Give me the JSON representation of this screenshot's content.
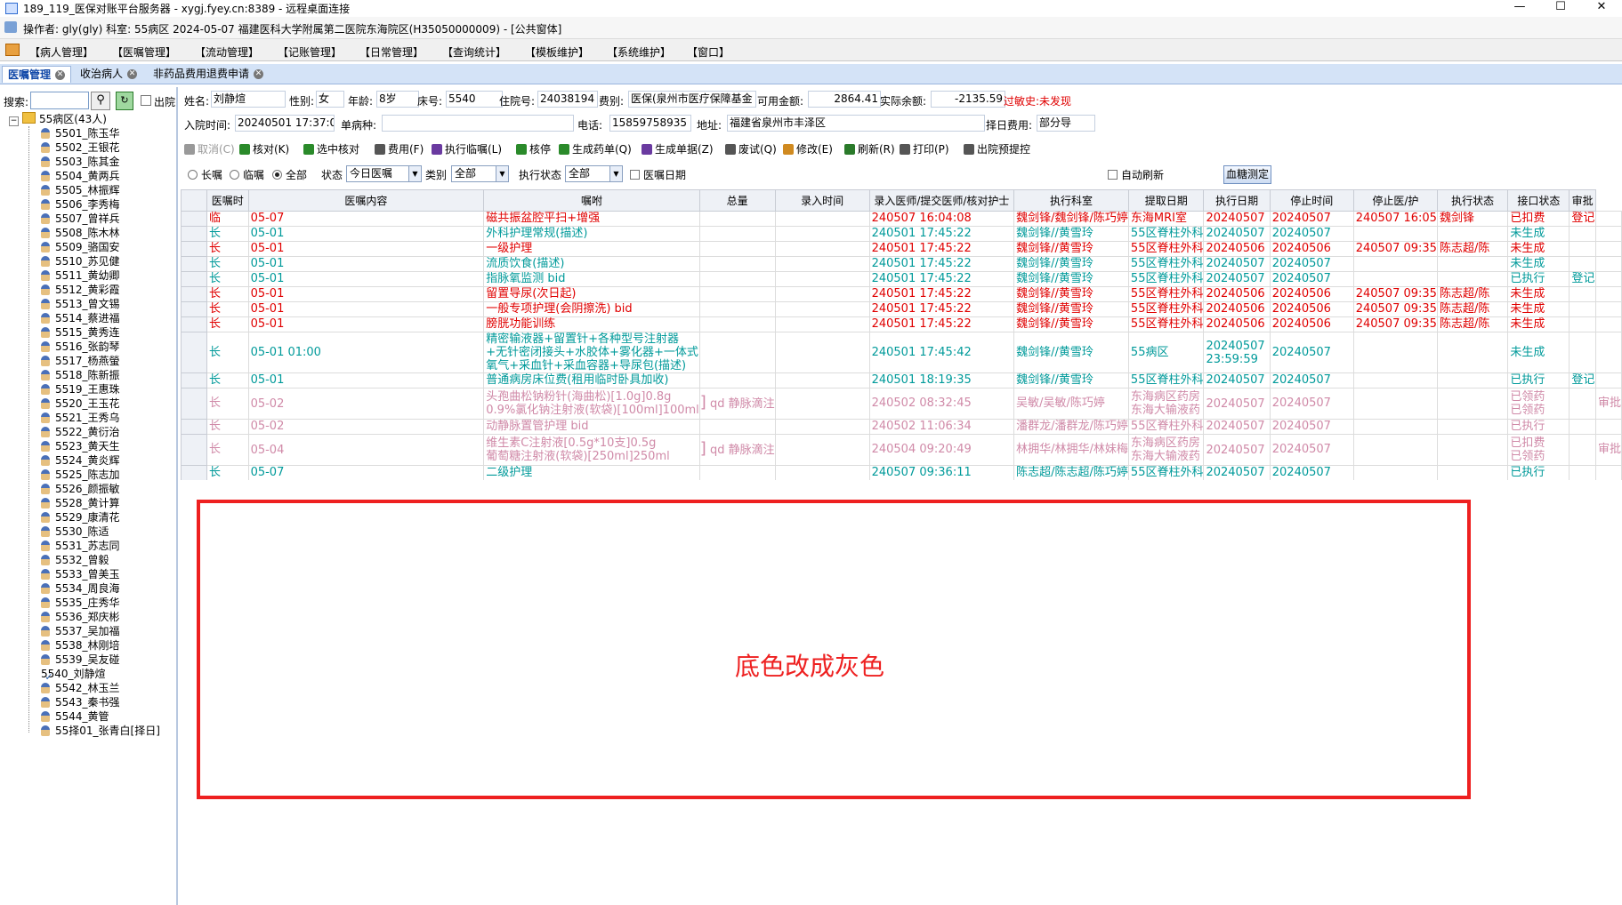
{
  "window": {
    "title": "189_119_医保对账平台服务器 - xygj.fyey.cn:8389 - 远程桌面连接",
    "buttons": [
      "—",
      "☐",
      "✕"
    ]
  },
  "infobar": {
    "text": "操作者: gly(gly)   科室: 55病区   2024-05-07   福建医科大学附属第二医院东海院区(H35050000009) - [公共窗体]"
  },
  "menu": [
    "【病人管理】",
    "【医嘱管理】",
    "【流动管理】",
    "【记账管理】",
    "【日常管理】",
    "【查询统计】",
    "【模板维护】",
    "【系统维护】",
    "【窗口】"
  ],
  "tabs": [
    {
      "label": "医嘱管理",
      "active": true
    },
    {
      "label": "收治病人",
      "active": false
    },
    {
      "label": "非药品费用退费申请",
      "active": false
    }
  ],
  "left": {
    "search_label": "搜索:",
    "discharge_label": "出院",
    "ward_label": "55病区(43人)",
    "patients": [
      "5501_陈玉华",
      "5502_王银花",
      "5503_陈其金",
      "5504_黄两兵",
      "5505_林振辉",
      "5506_李秀梅",
      "5507_曾祥兵",
      "5508_陈木林",
      "5509_骆国安",
      "5510_苏见健",
      "5511_黄幼卿",
      "5512_黄彩霞",
      "5513_曾文锡",
      "5514_蔡进福",
      "5515_黄秀连",
      "5516_张韵琴",
      "5517_杨燕螢",
      "5518_陈新振",
      "5519_王惠珠",
      "5520_王玉花",
      "5521_王秀乌",
      "5522_黄衍治",
      "5523_黄天生",
      "5524_黄炎辉",
      "5525_陈志加",
      "5526_颜振敏",
      "5528_黄计算",
      "5529_康清花",
      "5530_陈适",
      "5531_苏志同",
      "5532_曾毅",
      "5533_曾美玉",
      "5534_周良海",
      "5535_庄秀华",
      "5536_郑庆彬",
      "5537_吴加福",
      "5538_林刚培",
      "5539_吴友碰",
      "5540_刘静煊",
      "5542_林玉兰",
      "5543_秦书强",
      "5544_黄管",
      "55择01_张青白[择日]"
    ],
    "selected": "5540_刘静煊"
  },
  "form": {
    "name_label": "姓名:",
    "name": "刘静煊",
    "sex_label": "性别:",
    "sex": "女",
    "age_label": "年龄:",
    "age": "8岁",
    "bed_label": "床号:",
    "bed": "5540",
    "inpatient_label": "住院号:",
    "inpatient": "24038194",
    "feetype_label": "费别:",
    "feetype": "医保(泉州市医疗保障基金",
    "available_label": "可用金额:",
    "available": "2864.41",
    "balance_label": "实际余额:",
    "balance": "-2135.59",
    "allergy": "过敏史:未发现",
    "admit_label": "入院时间:",
    "admit": "20240501 17:37:04",
    "disease_label": "单病种:",
    "disease": "",
    "phone_label": "电话:",
    "phone": "15859758935",
    "address_label": "地址:",
    "address": "福建省泉州市丰泽区",
    "sched_label": "择日费用:",
    "sched": "部分导"
  },
  "toolbar": [
    {
      "label": "取消(C)",
      "color": "#999999",
      "disabled": true
    },
    {
      "label": "核对(K)",
      "color": "#2a8a2a"
    },
    {
      "label": "选中核对",
      "color": "#2a8a2a"
    },
    {
      "label": "费用(F)",
      "color": "#555555"
    },
    {
      "label": "执行临嘱(L)",
      "color": "#6a3aa0"
    },
    {
      "label": "核停",
      "color": "#2a8a2a"
    },
    {
      "label": "生成药单(Q)",
      "color": "#2a8a2a"
    },
    {
      "label": "生成单据(Z)",
      "color": "#6a3aa0"
    },
    {
      "label": "废试(Q)",
      "color": "#555555"
    },
    {
      "label": "修改(E)",
      "color": "#d08a20"
    },
    {
      "label": "刷新(R)",
      "color": "#2a7a2a"
    },
    {
      "label": "打印(P)",
      "color": "#555555"
    },
    {
      "label": "出院预提控",
      "color": "#555555"
    }
  ],
  "filter": {
    "long": "长嘱",
    "temp": "临嘱",
    "all": "全部",
    "status_label": "状态",
    "status": "今日医嘱",
    "type_label": "类别",
    "type": "全部",
    "exec_label": "执行状态",
    "exec": "全部",
    "date_label": "医嘱日期",
    "auto_refresh": "自动刷新",
    "blood": "血糖测定"
  },
  "table": {
    "headers": [
      "",
      "医嘱时",
      "医嘱内容",
      "嘱咐",
      "总量",
      "录入时间",
      "录入医师/提交医师/核对护士",
      "执行科室",
      "提取日期",
      "执行日期",
      "停止时间",
      "停止医/护",
      "执行状态",
      "接口状态",
      "审批"
    ],
    "rows": [
      {
        "c": "r",
        "t": "临",
        "d": "05-07",
        "content": "磁共振盆腔平扫+增强",
        "entry": "240507 16:04:08",
        "doc": "魏剑锋/魏剑锋/陈巧婷",
        "dept": "东海MRI室",
        "fetch": "20240507",
        "exec": "20240507",
        "stop": "240507 16:05",
        "stopdoc": "魏剑锋",
        "status": "已扣费",
        "iface": "登记",
        "appr": ""
      },
      {
        "c": "g",
        "t": "长",
        "d": "05-01",
        "content": "外科护理常规(描述)",
        "entry": "240501 17:45:22",
        "doc": "魏剑锋//黄雪玲",
        "dept": "55区脊柱外科",
        "fetch": "20240507",
        "exec": "20240507",
        "stop": "",
        "stopdoc": "",
        "status": "未生成",
        "iface": "",
        "appr": ""
      },
      {
        "c": "r",
        "t": "长",
        "d": "05-01",
        "content": "一级护理",
        "entry": "240501 17:45:22",
        "doc": "魏剑锋//黄雪玲",
        "dept": "55区脊柱外科",
        "fetch": "20240506",
        "exec": "20240506",
        "stop": "240507 09:35",
        "stopdoc": "陈志超/陈",
        "status": "未生成",
        "iface": "",
        "appr": ""
      },
      {
        "c": "g",
        "t": "长",
        "d": "05-01",
        "content": "流质饮食(描述)",
        "entry": "240501 17:45:22",
        "doc": "魏剑锋//黄雪玲",
        "dept": "55区脊柱外科",
        "fetch": "20240507",
        "exec": "20240507",
        "stop": "",
        "stopdoc": "",
        "status": "未生成",
        "iface": "",
        "appr": ""
      },
      {
        "c": "g",
        "t": "长",
        "d": "05-01",
        "content": "指脉氧监测 bid",
        "entry": "240501 17:45:22",
        "doc": "魏剑锋//黄雪玲",
        "dept": "55区脊柱外科",
        "fetch": "20240507",
        "exec": "20240507",
        "stop": "",
        "stopdoc": "",
        "status": "已执行",
        "iface": "登记",
        "appr": ""
      },
      {
        "c": "r",
        "t": "长",
        "d": "05-01",
        "content": "留置导尿(次日起)",
        "entry": "240501 17:45:22",
        "doc": "魏剑锋//黄雪玲",
        "dept": "55区脊柱外科",
        "fetch": "20240506",
        "exec": "20240506",
        "stop": "240507 09:35",
        "stopdoc": "陈志超/陈",
        "status": "未生成",
        "iface": "",
        "appr": ""
      },
      {
        "c": "r",
        "t": "长",
        "d": "05-01",
        "content": "一般专项护理(会阴擦洗) bid",
        "entry": "240501 17:45:22",
        "doc": "魏剑锋//黄雪玲",
        "dept": "55区脊柱外科",
        "fetch": "20240506",
        "exec": "20240506",
        "stop": "240507 09:35",
        "stopdoc": "陈志超/陈",
        "status": "未生成",
        "iface": "",
        "appr": ""
      },
      {
        "c": "r",
        "t": "长",
        "d": "05-01",
        "content": "膀胱功能训练",
        "entry": "240501 17:45:22",
        "doc": "魏剑锋//黄雪玲",
        "dept": "55区脊柱外科",
        "fetch": "20240506",
        "exec": "20240506",
        "stop": "240507 09:35",
        "stopdoc": "陈志超/陈",
        "status": "未生成",
        "iface": "",
        "appr": ""
      },
      {
        "c": "g",
        "t": "长",
        "d": "05-01 01:00",
        "content": "精密输液器+留置针+各种型号注射器+无针密闭接头+水胶体+雾化器+一体式氧气+采血针+采血容器+导尿包(描述)",
        "entry": "240501 17:45:42",
        "doc": "魏剑锋//黄雪玲",
        "dept": "55病区",
        "fetch": "20240507 23:59:59",
        "exec": "20240507",
        "stop": "",
        "stopdoc": "",
        "status": "未生成",
        "iface": "",
        "appr": "",
        "tall": true
      },
      {
        "c": "g",
        "t": "长",
        "d": "05-01",
        "content": "普通病房床位费(租用临时卧具加收)",
        "entry": "240501 18:19:35",
        "doc": "魏剑锋//黄雪玲",
        "dept": "55区脊柱外科",
        "fetch": "20240507",
        "exec": "20240507",
        "stop": "",
        "stopdoc": "",
        "status": "已执行",
        "iface": "登记",
        "appr": ""
      },
      {
        "c": "p",
        "t": "长",
        "d": "05-02",
        "content": "头孢曲松钠粉针(海曲松)[1.0g]0.8g|0.9%氯化钠注射液(软袋)[100ml]100ml",
        "usage": "qd 静脉滴注",
        "entry": "240502 08:32:45",
        "doc": "吴敏/吴敏/陈巧婷",
        "dept": "东海病区药房|东海大输液药",
        "fetch": "20240507",
        "exec": "20240507",
        "stop": "",
        "stopdoc": "",
        "status": "已领药|已领药",
        "iface": "",
        "appr": "审批",
        "tall": true
      },
      {
        "c": "p",
        "t": "长",
        "d": "05-02",
        "content": "动静脉置管护理 bid",
        "entry": "240502 11:06:34",
        "doc": "潘群龙/潘群龙/陈巧婷",
        "dept": "55区脊柱外科",
        "fetch": "20240507",
        "exec": "20240507",
        "stop": "",
        "stopdoc": "",
        "status": "已执行",
        "iface": "",
        "appr": ""
      },
      {
        "c": "p",
        "t": "长",
        "d": "05-04",
        "content": "维生素C注射液[0.5g*10支]0.5g|葡萄糖注射液(软袋)[250ml]250ml",
        "usage": "qd 静脉滴注",
        "entry": "240504 09:20:49",
        "doc": "林拥华/林拥华/林妹梅",
        "dept": "东海病区药房|东海大输液药",
        "fetch": "20240507",
        "exec": "20240507",
        "stop": "",
        "stopdoc": "",
        "status": "已扣费|已领药",
        "iface": "",
        "appr": "审批",
        "tall": true
      },
      {
        "c": "g",
        "t": "长",
        "d": "05-07",
        "content": "二级护理",
        "entry": "240507 09:36:11",
        "doc": "陈志超/陈志超/陈巧婷",
        "dept": "55区脊柱外科",
        "fetch": "20240507",
        "exec": "20240507",
        "stop": "",
        "stopdoc": "",
        "status": "已执行",
        "iface": "",
        "appr": ""
      }
    ]
  },
  "annotation": {
    "text": "底色改成灰色",
    "color": "#ee2020"
  }
}
